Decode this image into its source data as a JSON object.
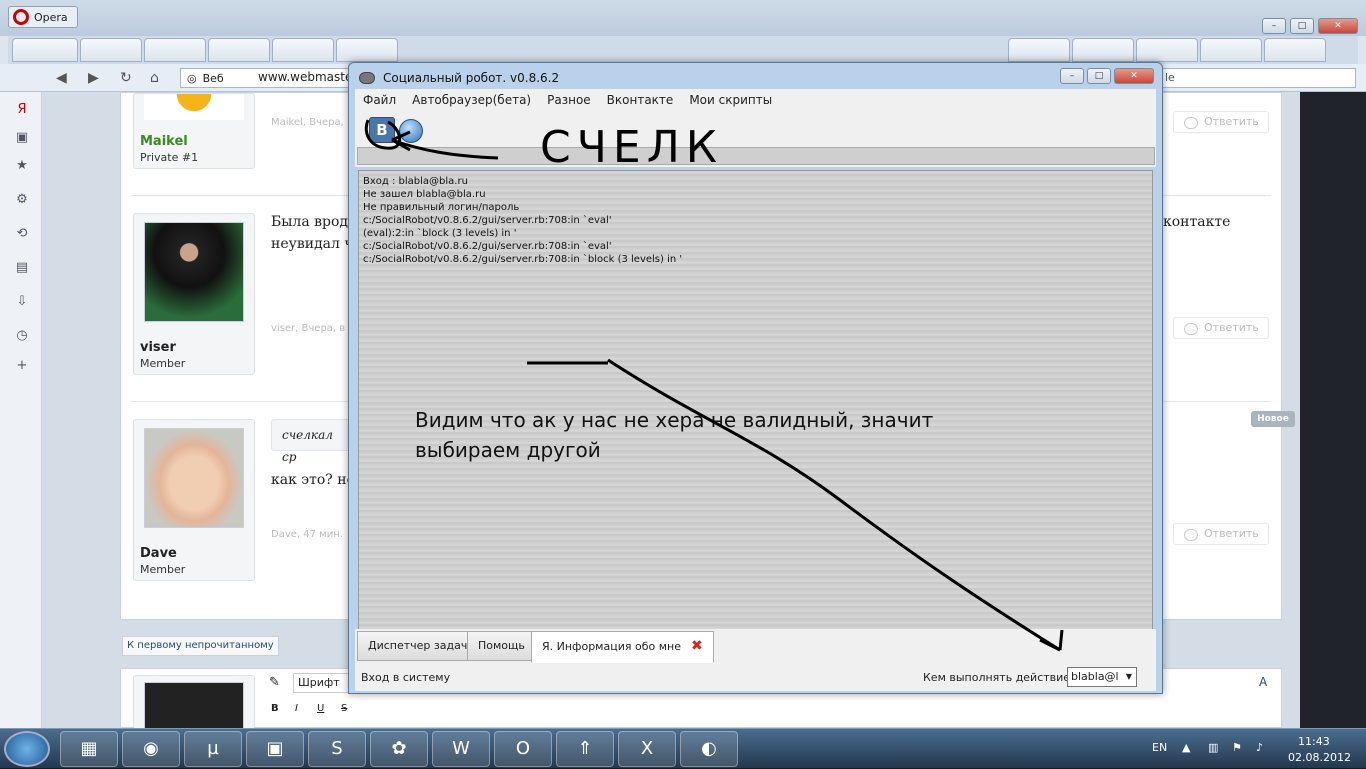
{
  "opera": {
    "title": "Opera",
    "address_label": "Веб",
    "address_url": "www.webmaste",
    "address_right": "le"
  },
  "forum": {
    "posts": [
      {
        "username": "Maikel",
        "role": "Private #1",
        "meta": "Maikel, Вчера,",
        "reply": "Ответить"
      },
      {
        "username": "viser",
        "role": "Member",
        "meta": "viser, Вчера, в",
        "reply": "Ответить",
        "text_line1": "Была врод",
        "text_line2": "неувидал ч",
        "text_right": "контакте"
      },
      {
        "username": "Dave",
        "role": "Member",
        "meta": "Dave, 47 мин.",
        "reply": "Ответить",
        "quote": "счелкал ср",
        "text_line1": "как это? не"
      }
    ],
    "new_badge": "Новое",
    "first_unread": "К первому непрочитанному",
    "editor_font": "Шрифт"
  },
  "robot": {
    "title": "Социальный робот. v0.8.6.2",
    "menu": [
      "Файл",
      "Автобраузер(бета)",
      "Разное",
      "Вконтакте",
      "Мои скрипты"
    ],
    "vk_label": "В",
    "handwritten": "СЧЕЛК",
    "log": [
      "Вход : blabla@bla.ru",
      "Не зашел blabla@bla.ru",
      "Не правильный логин/пароль",
      "c:/SocialRobot/v0.8.6.2/gui/server.rb:708:in `eval'",
      "(eval):2:in `block (3 levels) in '",
      "c:/SocialRobot/v0.8.6.2/gui/server.rb:708:in `eval'",
      "c:/SocialRobot/v0.8.6.2/gui/server.rb:708:in `block (3 levels) in '"
    ],
    "annotation_line1": "Видим что ак у нас не хера не валидный, значит",
    "annotation_line2": "выбираем другой",
    "tabs": [
      "Диспетчер задач",
      "Помощь",
      "Я. Информация обо мне"
    ],
    "status": "Вход в систему",
    "who_label": "Кем выполнять действие",
    "who_value": "blabla@l"
  },
  "taskbar": {
    "lang": "EN",
    "time": "11:43",
    "date": "02.08.2012"
  }
}
